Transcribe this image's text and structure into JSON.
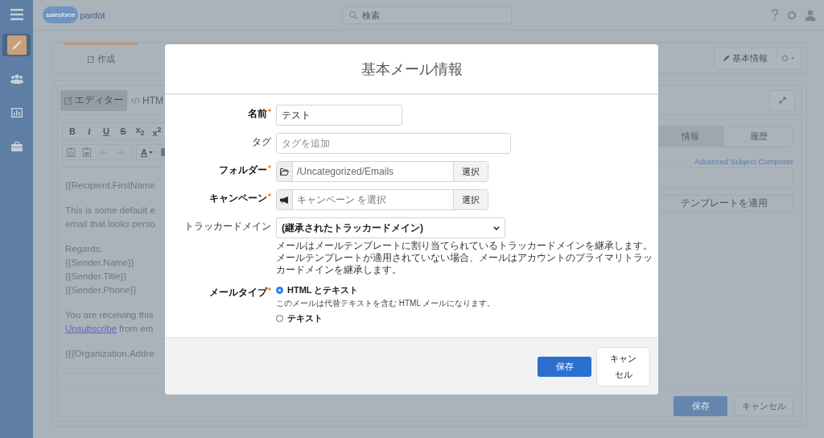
{
  "app_header": {
    "logo": {
      "brand": "salesforce",
      "product": "pardot"
    },
    "search": {
      "placeholder": "検索"
    }
  },
  "sidebar": {
    "items": [
      {
        "selected": true
      },
      {
        "selected": false
      },
      {
        "selected": false
      },
      {
        "selected": false
      }
    ]
  },
  "page_tabs": [
    {
      "label": "作成",
      "selected": true
    }
  ],
  "page_actions": {
    "edit_button": "基本情報"
  },
  "editor": {
    "tabs": [
      {
        "label": "エディター",
        "selected": true
      },
      {
        "label": "HTM",
        "selected": false
      }
    ],
    "toolbar": [
      {
        "label": "B",
        "kind": "bold"
      },
      {
        "label": "I",
        "kind": "italic"
      },
      {
        "label": "U",
        "kind": "underline"
      },
      {
        "label": "S",
        "kind": "strike"
      },
      {
        "label": "x$_{2}$",
        "kind": "subscript"
      },
      {
        "label": "x$^{2}$",
        "kind": "superscript"
      }
    ],
    "color_button": "A",
    "body": [
      [
        [
          {
            "kind": "text",
            "text": "{{Recipient.FirstName"
          }
        ]
      ],
      [
        [
          {
            "kind": "text",
            "text": "This is some default e"
          }
        ],
        [
          {
            "kind": "text",
            "text": "email that looks perso"
          }
        ]
      ],
      [
        [
          {
            "kind": "text",
            "text": "Regards,"
          }
        ],
        [
          {
            "kind": "text",
            "text": "{{Sender.Name}}"
          }
        ],
        [
          {
            "kind": "text",
            "text": "{{Sender.Title}}"
          }
        ],
        [
          {
            "kind": "text",
            "text": "{{Sender.Phone}}"
          }
        ]
      ],
      [
        [
          {
            "kind": "text",
            "text": "You are receiving this"
          }
        ],
        [
          {
            "kind": "link",
            "text": "Unsubscribe"
          },
          {
            "kind": "text",
            "text": " from em"
          }
        ]
      ],
      [
        [
          {
            "kind": "text",
            "text": "{{{Organization.Addre"
          }
        ]
      ]
    ]
  },
  "side_panel": {
    "tabs": [
      {
        "label": "情報",
        "selected": true
      },
      {
        "label": "履歴",
        "selected": false
      }
    ],
    "link": "Advanced Subject Composer",
    "template_button": "テンプレートを適用"
  },
  "footer_buttons": {
    "save": "保存",
    "cancel": "キャンセル"
  },
  "modal": {
    "title": "基本メール情報",
    "fields": [
      {
        "label": "名前",
        "required": true,
        "kind": "text",
        "value": "テスト"
      },
      {
        "label": "タグ",
        "required": false,
        "kind": "tags",
        "placeholder": "タグを追加"
      },
      {
        "label": "フォルダー",
        "required": true,
        "kind": "picker",
        "value": "/Uncategorized/Emails",
        "button": "選択"
      },
      {
        "label": "キャンペーン",
        "required": true,
        "kind": "picker",
        "placeholder": "キャンペーン を選択",
        "button": "選択"
      },
      {
        "label": "トラッカードメイン",
        "required": false,
        "kind": "select",
        "value": "(継承されたトラッカードメイン)",
        "help": [
          "メールはメールテンプレートに割り当てられているトラッカードメインを継承します。",
          "メールテンプレートが適用されていない場合、メールはアカウントのプライマリトラッカードメインを継承します。"
        ]
      },
      {
        "label": "メールタイプ",
        "required": true,
        "kind": "radio",
        "options": [
          {
            "label": "HTML とテキスト",
            "selected": true,
            "help": "このメールは代替テキストを含む HTML メールになります。"
          },
          {
            "label": "テキスト",
            "selected": false
          }
        ]
      }
    ],
    "save_button": "保存",
    "cancel_button": "キャンセル"
  }
}
